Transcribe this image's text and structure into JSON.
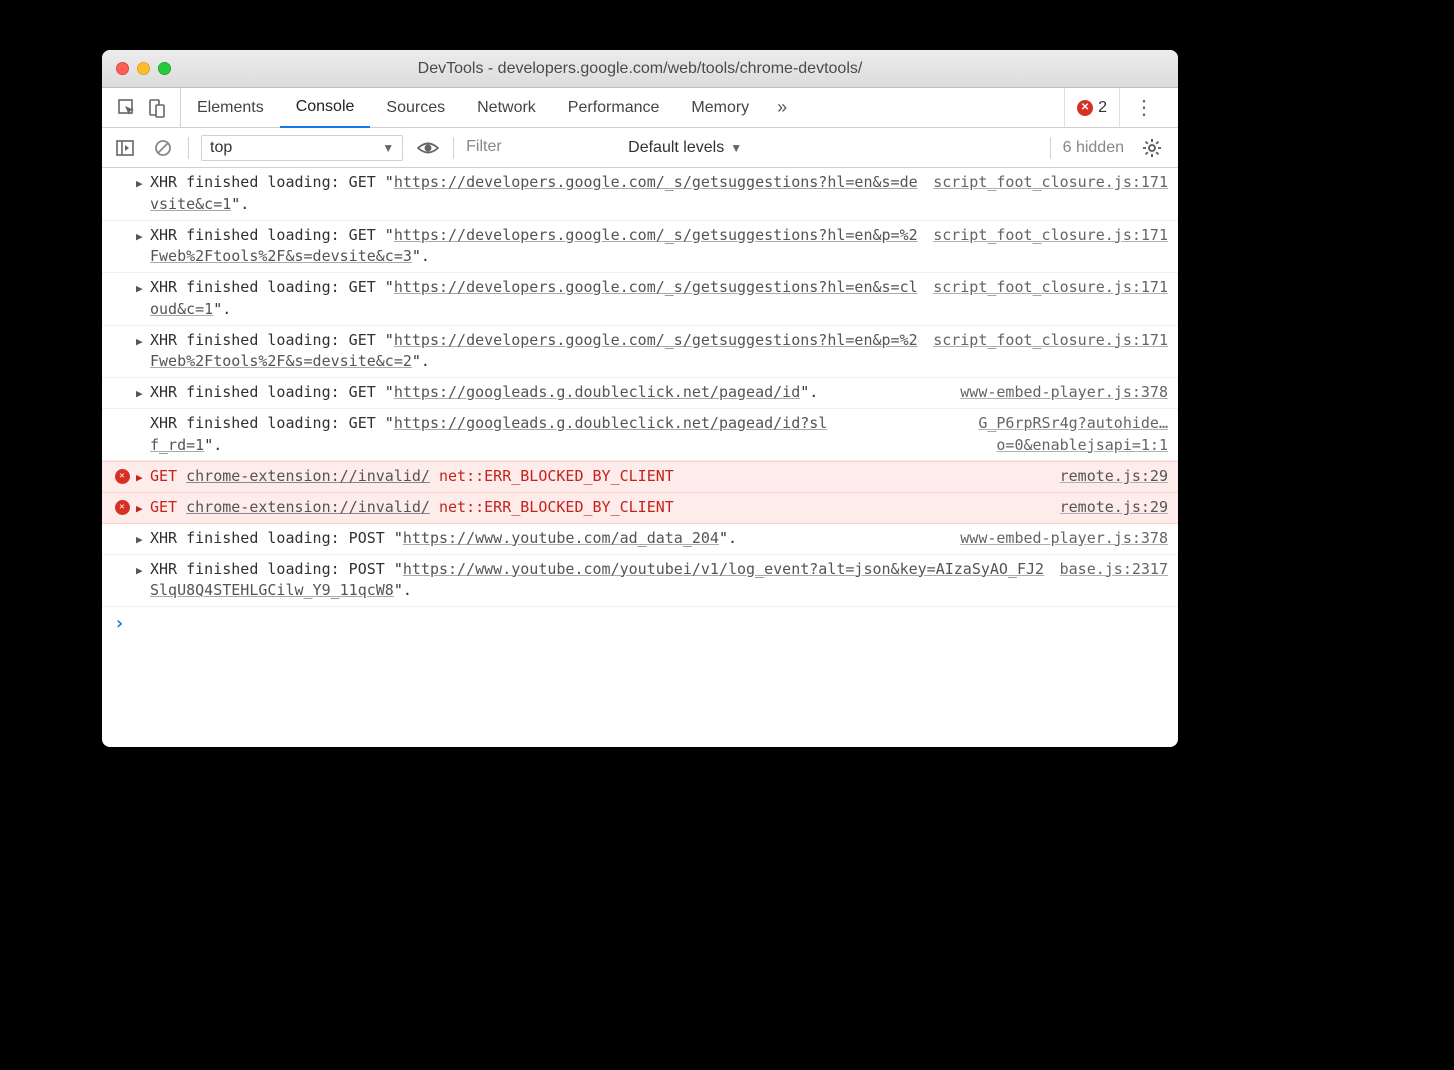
{
  "window": {
    "title": "DevTools - developers.google.com/web/tools/chrome-devtools/"
  },
  "tabs": {
    "items": [
      "Elements",
      "Console",
      "Sources",
      "Network",
      "Performance",
      "Memory"
    ],
    "active_index": 1,
    "overflow_glyph": "»",
    "error_count": "2"
  },
  "filterbar": {
    "context": "top",
    "filter_placeholder": "Filter",
    "levels_label": "Default levels",
    "hidden_label": "6 hidden"
  },
  "messages": [
    {
      "type": "xhr",
      "prefix": "XHR finished loading: GET \"",
      "url": "https://developers.google.com/_s/getsuggestions?hl=en&s=devsite&c=1",
      "suffix": "\".",
      "source": "script_foot_closure.js:171",
      "has_toggle": true
    },
    {
      "type": "xhr",
      "prefix": "XHR finished loading: GET \"",
      "url": "https://developers.google.com/_s/getsuggestions?hl=en&p=%2Fweb%2Ftools%2F&s=devsite&c=3",
      "suffix": "\".",
      "source": "script_foot_closure.js:171",
      "has_toggle": true
    },
    {
      "type": "xhr",
      "prefix": "XHR finished loading: GET \"",
      "url": "https://developers.google.com/_s/getsuggestions?hl=en&s=cloud&c=1",
      "suffix": "\".",
      "source": "script_foot_closure.js:171",
      "has_toggle": true
    },
    {
      "type": "xhr",
      "prefix": "XHR finished loading: GET \"",
      "url": "https://developers.google.com/_s/getsuggestions?hl=en&p=%2Fweb%2Ftools%2F&s=devsite&c=2",
      "suffix": "\".",
      "source": "script_foot_closure.js:171",
      "has_toggle": true
    },
    {
      "type": "xhr",
      "prefix": "XHR finished loading: GET \"",
      "url": "https://googleads.g.doubleclick.net/pagead/id",
      "suffix": "\".",
      "source": "www-embed-player.js:378",
      "has_toggle": true
    },
    {
      "type": "xhr",
      "prefix": "XHR finished loading: GET \"",
      "url": "https://googleads.g.doubleclick.net/pagead/id?slf_rd=1",
      "suffix": "\".",
      "source": "G_P6rpRSr4g?autohide…o=0&enablejsapi=1:1",
      "has_toggle": false
    },
    {
      "type": "error",
      "method": "GET",
      "url": "chrome-extension://invalid/",
      "err": "net::ERR_BLOCKED_BY_CLIENT",
      "source": "remote.js:29",
      "has_toggle": true
    },
    {
      "type": "error",
      "method": "GET",
      "url": "chrome-extension://invalid/",
      "err": "net::ERR_BLOCKED_BY_CLIENT",
      "source": "remote.js:29",
      "has_toggle": true
    },
    {
      "type": "xhr",
      "prefix": "XHR finished loading: POST \"",
      "url": "https://www.youtube.com/ad_data_204",
      "suffix": "\".",
      "source": "www-embed-player.js:378",
      "has_toggle": true
    },
    {
      "type": "xhr",
      "prefix": "XHR finished loading: POST \"",
      "url": "https://www.youtube.com/youtubei/v1/log_event?alt=json&key=AIzaSyAO_FJ2SlqU8Q4STEHLGCilw_Y9_11qcW8",
      "suffix": "\".",
      "source": "base.js:2317",
      "has_toggle": true
    }
  ]
}
